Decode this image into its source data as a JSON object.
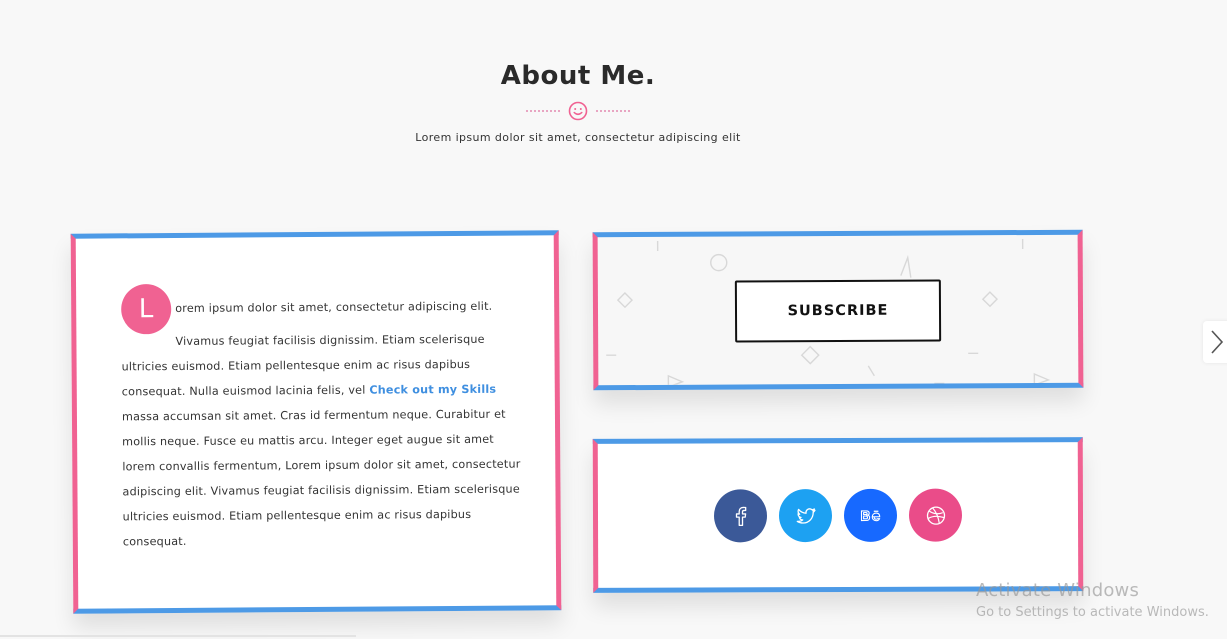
{
  "section": {
    "title": "About Me.",
    "subtitle": "Lorem ipsum dolor sit amet, consectetur adipiscing elit"
  },
  "about": {
    "dropcap": "L",
    "first_line": "orem ipsum dolor sit amet, consectetur adipiscing elit.",
    "text_before_link": "Vivamus feugiat facilisis dignissim. Etiam scelerisque ultricies euismod. Etiam pellentesque enim ac risus dapibus consequat. Nulla euismod lacinia felis, vel ",
    "link_text": "Check out my Skills",
    "text_after_link": " massa accumsan sit amet. Cras id fermentum neque. Curabitur et mollis neque. Fusce eu mattis arcu. Integer eget augue sit amet lorem convallis fermentum, Lorem ipsum dolor sit amet, consectetur adipiscing elit. Vivamus feugiat facilisis dignissim. Etiam scelerisque ultricies euismod. Etiam pellentesque enim ac risus dapibus consequat."
  },
  "subscribe": {
    "button_label": "SUBSCRIBE"
  },
  "social": [
    {
      "name": "facebook-icon",
      "color": "#3b5998"
    },
    {
      "name": "twitter-icon",
      "color": "#1da1f2"
    },
    {
      "name": "behance-icon",
      "color": "#1769ff"
    },
    {
      "name": "dribbble-icon",
      "color": "#ea4c89"
    }
  ],
  "colors": {
    "accent_pink": "#f06292",
    "accent_blue": "#4d9ae6",
    "link_blue": "#3f8fe0"
  },
  "watermark": {
    "title": "Activate Windows",
    "subtitle": "Go to Settings to activate Windows."
  }
}
